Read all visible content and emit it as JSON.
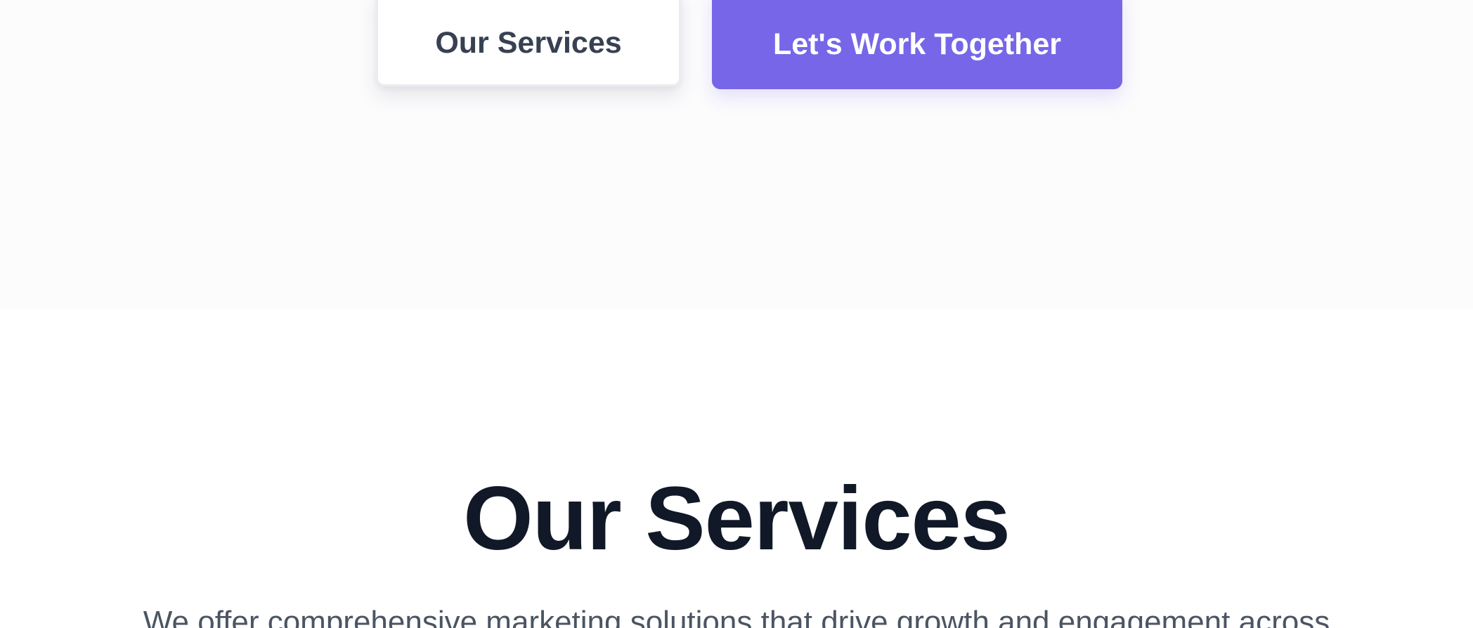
{
  "hero": {
    "buttons": {
      "secondary_label": "Our Services",
      "primary_label": "Let's Work Together"
    }
  },
  "services": {
    "title": "Our Services",
    "subtitle": "We offer comprehensive marketing solutions that drive growth and engagement across"
  },
  "colors": {
    "primary_button": "#7766e8",
    "title_text": "#111827",
    "body_text": "#4b5563",
    "hero_background": "#fcfcfd"
  }
}
